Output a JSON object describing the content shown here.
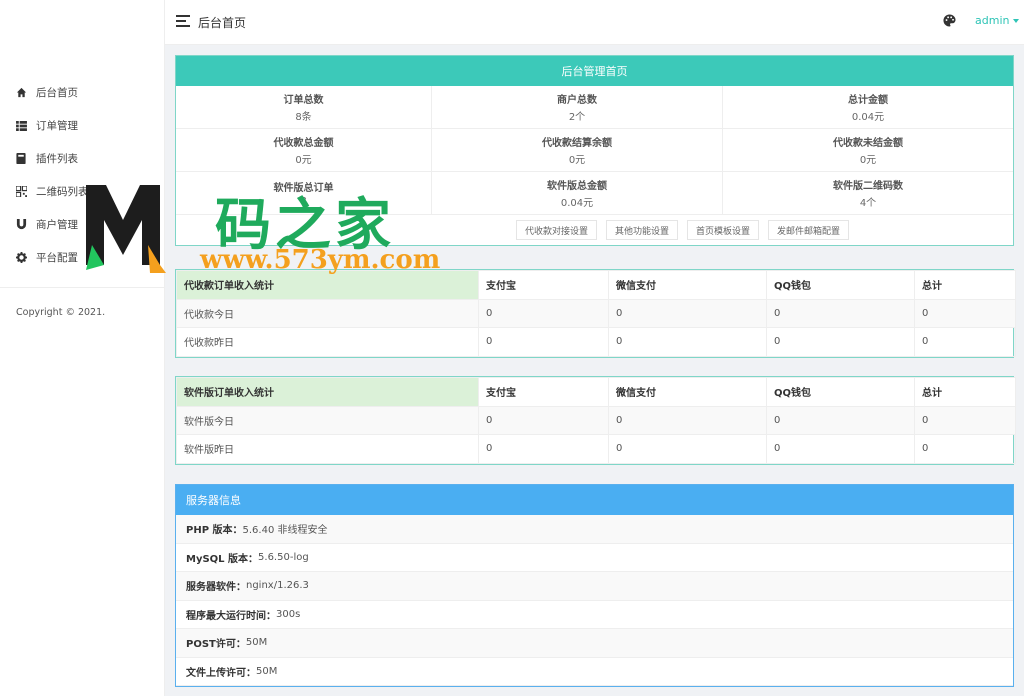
{
  "sidebar": {
    "items": [
      {
        "label": "后台首页",
        "icon": "home-icon"
      },
      {
        "label": "订单管理",
        "icon": "list-icon"
      },
      {
        "label": "插件列表",
        "icon": "book-icon"
      },
      {
        "label": "二维码列表",
        "icon": "qrcode-icon"
      },
      {
        "label": "商户管理",
        "icon": "magnet-icon"
      },
      {
        "label": "平台配置",
        "icon": "gear-icon"
      }
    ],
    "copyright": "Copyright © 2021."
  },
  "topbar": {
    "title": "后台首页",
    "user": "admin"
  },
  "dashboard": {
    "title": "后台管理首页",
    "stats": [
      {
        "label": "订单总数",
        "value": "8条"
      },
      {
        "label": "商户总数",
        "value": "2个"
      },
      {
        "label": "总计金额",
        "value": "0.04元"
      },
      {
        "label": "代收款总金额",
        "value": "0元"
      },
      {
        "label": "代收款结算余额",
        "value": "0元"
      },
      {
        "label": "代收款未结金额",
        "value": "0元"
      },
      {
        "label": "软件版总订单",
        "value": "8"
      },
      {
        "label": "软件版总金额",
        "value": "0.04元"
      },
      {
        "label": "软件版二维码数",
        "value": "4个"
      }
    ],
    "links": [
      "代收款对接设置",
      "其他功能设置",
      "首页模板设置",
      "发邮件邮箱配置"
    ]
  },
  "collection_table": {
    "headers": [
      "代收款订单收入统计",
      "支付宝",
      "微信支付",
      "QQ钱包",
      "总计"
    ],
    "rows": [
      [
        "代收款今日",
        "0",
        "0",
        "0",
        "0"
      ],
      [
        "代收款昨日",
        "0",
        "0",
        "0",
        "0"
      ]
    ]
  },
  "software_table": {
    "headers": [
      "软件版订单收入统计",
      "支付宝",
      "微信支付",
      "QQ钱包",
      "总计"
    ],
    "rows": [
      [
        "软件版今日",
        "0",
        "0",
        "0",
        "0"
      ],
      [
        "软件版昨日",
        "0",
        "0",
        "0",
        "0"
      ]
    ]
  },
  "server": {
    "title": "服务器信息",
    "rows": [
      {
        "key": "PHP 版本：",
        "value": "5.6.40 非线程安全"
      },
      {
        "key": "MySQL 版本：",
        "value": "5.6.50-log"
      },
      {
        "key": "服务器软件：",
        "value": "nginx/1.26.3"
      },
      {
        "key": "程序最大运行时间：",
        "value": "300s"
      },
      {
        "key": "POST许可：",
        "value": "50M"
      },
      {
        "key": "文件上传许可：",
        "value": "50M"
      }
    ]
  },
  "watermark": {
    "title": "码之家",
    "url": "www.573ym.com"
  },
  "colors": {
    "accent": "#3cc9b9",
    "info": "#4aaef2",
    "highlight": "#dbf1d8"
  }
}
